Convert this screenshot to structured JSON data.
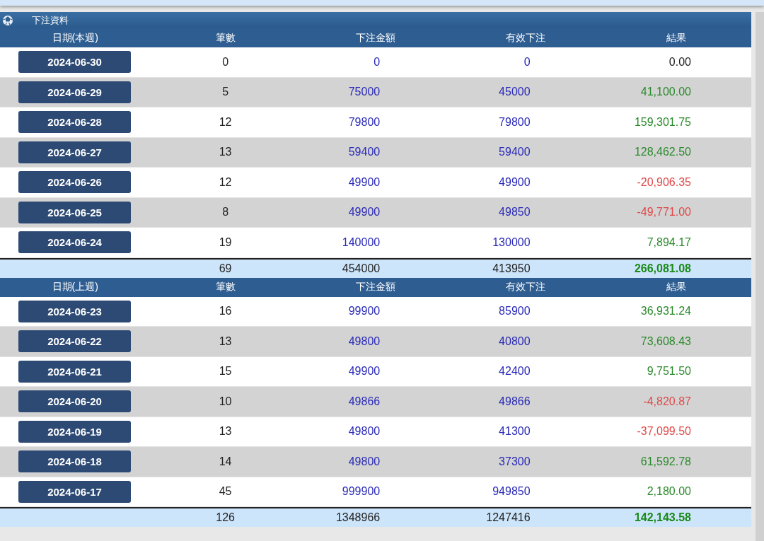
{
  "panel": {
    "title": "下注資料"
  },
  "sections": [
    {
      "columns": [
        "日期(本週)",
        "筆數",
        "下注金額",
        "有效下注",
        "結果"
      ],
      "rows": [
        {
          "date": "2024-06-30",
          "count": "0",
          "bet": "0",
          "valid": "0",
          "result": "0.00",
          "color": "#222222"
        },
        {
          "date": "2024-06-29",
          "count": "5",
          "bet": "75000",
          "valid": "45000",
          "result": "41,100.00",
          "color": "#2a8a2a"
        },
        {
          "date": "2024-06-28",
          "count": "12",
          "bet": "79800",
          "valid": "79800",
          "result": "159,301.75",
          "color": "#2a8a2a"
        },
        {
          "date": "2024-06-27",
          "count": "13",
          "bet": "59400",
          "valid": "59400",
          "result": "128,462.50",
          "color": "#2a8a2a"
        },
        {
          "date": "2024-06-26",
          "count": "12",
          "bet": "49900",
          "valid": "49900",
          "result": "-20,906.35",
          "color": "#e04848"
        },
        {
          "date": "2024-06-25",
          "count": "8",
          "bet": "49900",
          "valid": "49850",
          "result": "-49,771.00",
          "color": "#e04848"
        },
        {
          "date": "2024-06-24",
          "count": "19",
          "bet": "140000",
          "valid": "130000",
          "result": "7,894.17",
          "color": "#2a8a2a"
        }
      ],
      "total": {
        "count": "69",
        "bet": "454000",
        "valid": "413950",
        "result": "266,081.08"
      }
    },
    {
      "columns": [
        "日期(上週)",
        "筆數",
        "下注金額",
        "有效下注",
        "結果"
      ],
      "rows": [
        {
          "date": "2024-06-23",
          "count": "16",
          "bet": "99900",
          "valid": "85900",
          "result": "36,931.24",
          "color": "#2a8a2a"
        },
        {
          "date": "2024-06-22",
          "count": "13",
          "bet": "49800",
          "valid": "40800",
          "result": "73,608.43",
          "color": "#2a8a2a"
        },
        {
          "date": "2024-06-21",
          "count": "15",
          "bet": "49900",
          "valid": "42400",
          "result": "9,751.50",
          "color": "#2a8a2a"
        },
        {
          "date": "2024-06-20",
          "count": "10",
          "bet": "49866",
          "valid": "49866",
          "result": "-4,820.87",
          "color": "#e04848"
        },
        {
          "date": "2024-06-19",
          "count": "13",
          "bet": "49800",
          "valid": "41300",
          "result": "-37,099.50",
          "color": "#e04848"
        },
        {
          "date": "2024-06-18",
          "count": "14",
          "bet": "49800",
          "valid": "37300",
          "result": "61,592.78",
          "color": "#2a8a2a"
        },
        {
          "date": "2024-06-17",
          "count": "45",
          "bet": "999900",
          "valid": "949850",
          "result": "2,180.00",
          "color": "#2a8a2a"
        }
      ],
      "total": {
        "count": "126",
        "bet": "1348966",
        "valid": "1247416",
        "result": "142,143.58"
      }
    }
  ]
}
